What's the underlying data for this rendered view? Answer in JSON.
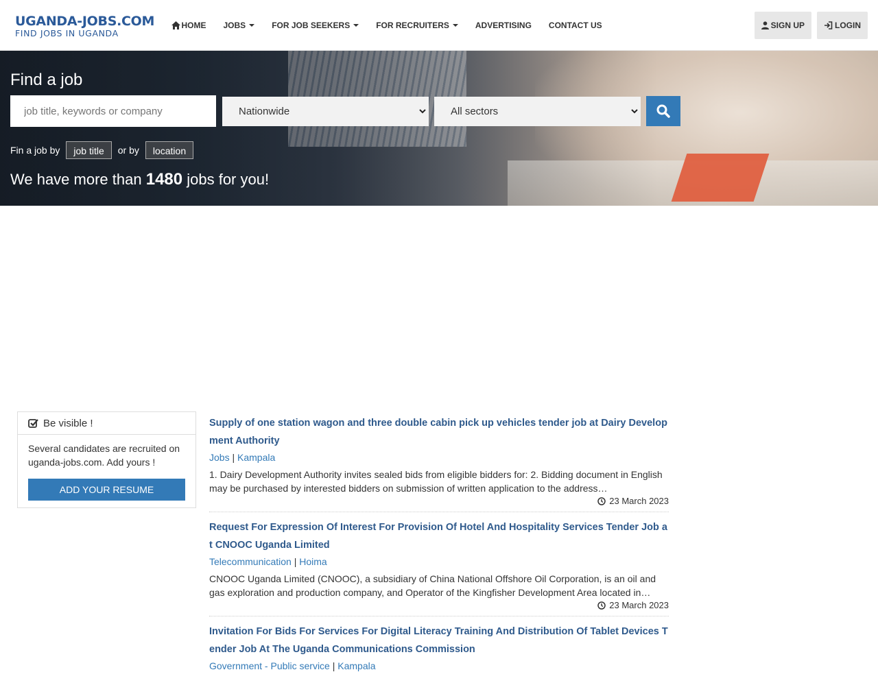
{
  "header": {
    "logo_main": "UGANDA-JOBS.COM",
    "logo_sub": "FIND JOBS IN UGANDA",
    "nav": {
      "home": "HOME",
      "jobs": "JOBS",
      "job_seekers": "FOR JOB SEEKERS",
      "recruiters": "FOR RECRUITERS",
      "advertising": "ADVERTISING",
      "contact": "CONTACT US"
    },
    "signup": "SIGN UP",
    "login": "LOGIN"
  },
  "hero": {
    "title": "Find a job",
    "search_placeholder": "job title, keywords or company",
    "location_selected": "Nationwide",
    "sector_selected": "All sectors",
    "findby_prefix": "Fin a job by",
    "findby_title": "job title",
    "findby_or": "or by",
    "findby_location": "location",
    "count_prefix": "We have more than",
    "count_value": "1480",
    "count_suffix": "jobs for you!"
  },
  "sidebar": {
    "panel_title": "Be visible !",
    "panel_text": "Several candidates are recruited on uganda-jobs.com. Add yours !",
    "panel_button": "ADD YOUR RESUME"
  },
  "jobs": [
    {
      "title": "Supply of one station wagon and three double cabin pick up vehicles tender job at Dairy Development Authority",
      "category": "Jobs",
      "location": "Kampala",
      "description": "1. Dairy Development Authority invites sealed bids from eligible bidders for: 2. Bidding document in English may be purchased by interested bidders on submission of written application to the address…",
      "date": "23 March 2023"
    },
    {
      "title": "Request For Expression Of Interest For Provision Of Hotel And Hospitality Services Tender Job at CNOOC Uganda Limited",
      "category": "Telecommunication",
      "location": "Hoima",
      "description": "CNOOC Uganda Limited (CNOOC), a subsidiary of China National Offshore Oil Corporation, is an oil and gas exploration and production company, and Operator of the Kingfisher Development Area located in…",
      "date": "23 March 2023"
    },
    {
      "title": "Invitation For Bids For Services For Digital Literacy Training And Distribution Of Tablet Devices Tender Job At The Uganda Communications Commission",
      "category": "Government - Public service",
      "location": "Kampala"
    }
  ],
  "colors": {
    "brand": "#2b5a99",
    "primary_button": "#337ab7",
    "job_title": "#2f5a8c"
  }
}
